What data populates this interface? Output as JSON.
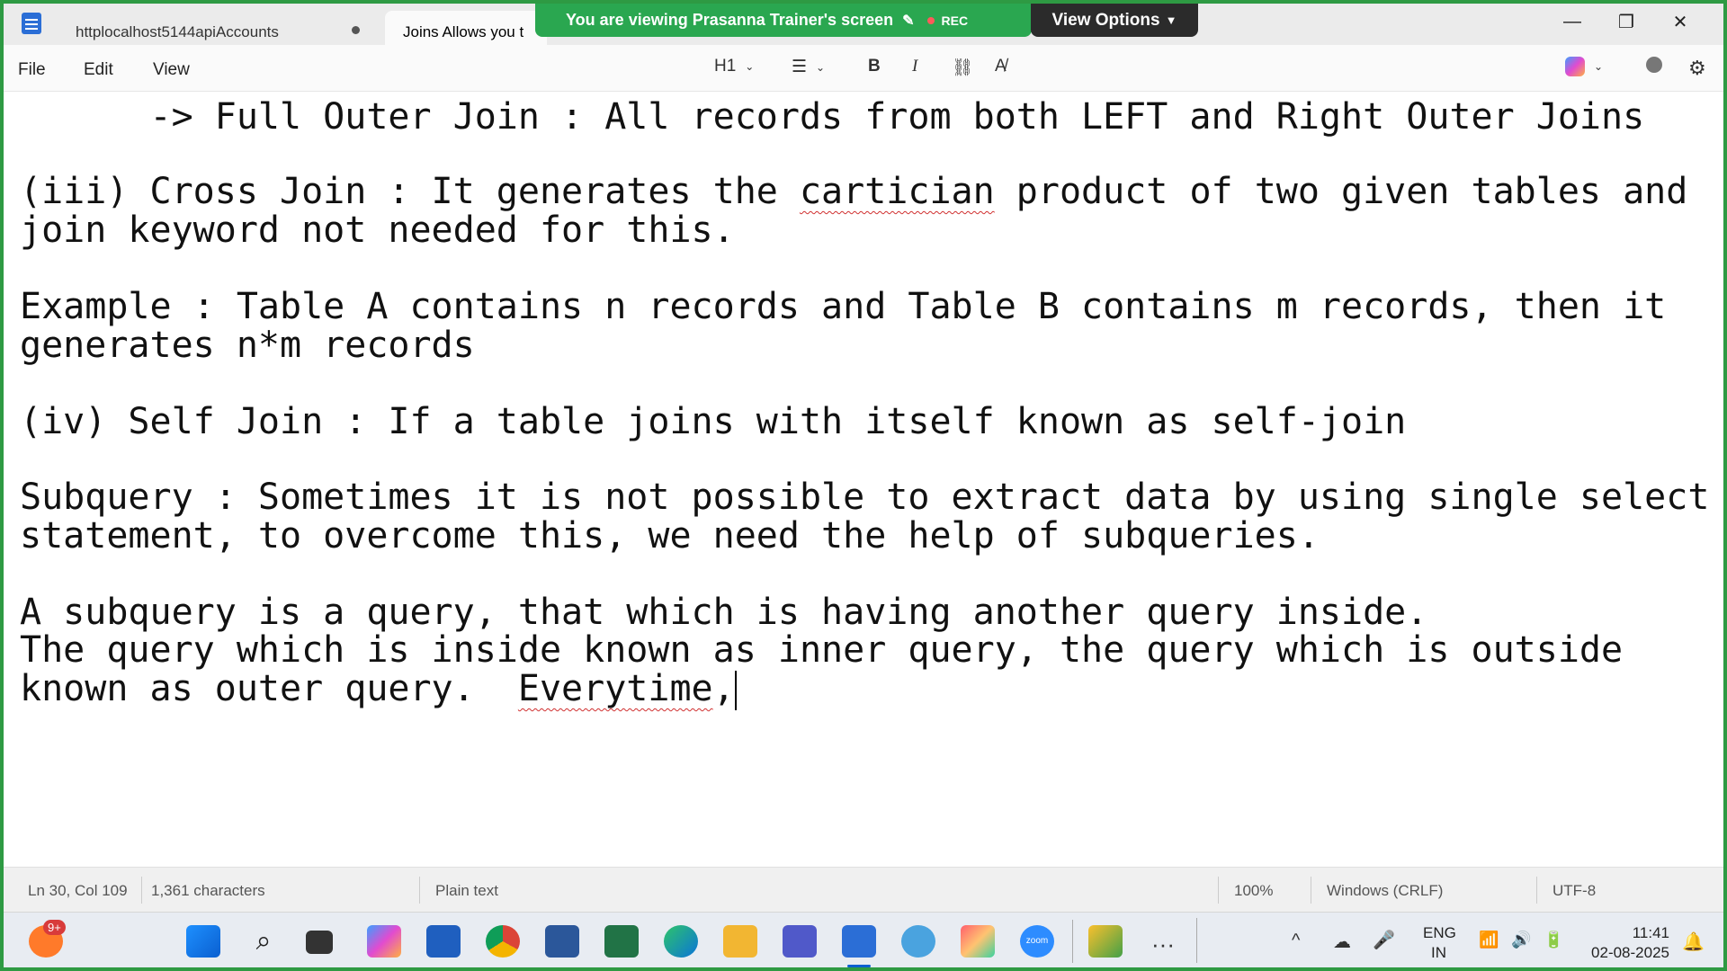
{
  "tabs": [
    {
      "label": "httplocalhost5144apiAccounts"
    },
    {
      "label": "Joins  Allows you t"
    }
  ],
  "share_banner": {
    "text": "You are viewing  Prasanna Trainer's screen",
    "rec": "REC",
    "view_options": "View Options"
  },
  "menu": {
    "file": "File",
    "edit": "Edit",
    "view": "View"
  },
  "toolbar": {
    "heading": "H1"
  },
  "editor": {
    "lines": [
      "      -> Full Outer Join : All records from both LEFT and Right Outer Joins",
      "",
      "(iii) Cross Join : It generates the ",
      "join keyword not needed for this.",
      "",
      "Example : Table A contains n records and Table B contains m records, then it",
      "generates n*m records",
      "",
      "(iv) Self Join : If a table joins with itself known as self-join",
      "",
      "Subquery : Sometimes it is not possible to extract data by using single select",
      "statement, to overcome this, we need the help of subqueries.",
      "",
      "A subquery is a query, that which is having another query inside.",
      "The query which is inside known as inner query, the query which is outside",
      "known as outer query.  "
    ],
    "cross_join_misspelled": "cartician",
    "cross_join_tail": " product of two given tables and",
    "last_misspelled": "Everytime",
    "last_tail": ","
  },
  "status": {
    "position": "Ln 30, Col 109",
    "characters": "1,361 characters",
    "format": "Plain text",
    "zoom": "100%",
    "line_ending": "Windows (CRLF)",
    "encoding": "UTF-8"
  },
  "taskbar": {
    "notification_badge": "9+",
    "lang": "ENG",
    "region": "IN",
    "time": "11:41",
    "date": "02-08-2025",
    "zoom_label": "zoom"
  }
}
